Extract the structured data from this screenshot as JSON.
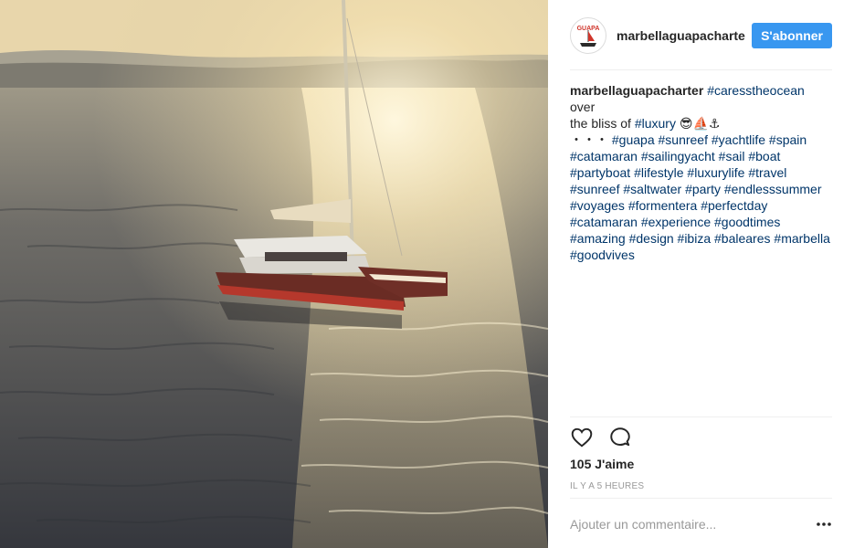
{
  "post": {
    "username": "marbellaguapacharte",
    "avatar_text": "GUAPA",
    "follow_label": "S'abonner",
    "caption": {
      "author": "marbellaguapacharter",
      "line1_tag": "#caresstheocean",
      "line1_text": "over",
      "line2_text": "the bliss of",
      "line2_tag": "#luxury",
      "line2_emoji": "😎⛵⚓",
      "line3_dots": "・・・",
      "hashtags": [
        "#guapa",
        "#sunreef",
        "#yachtlife",
        "#spain",
        "#catamaran",
        "#sailingyacht",
        "#sail",
        "#boat",
        "#partyboat",
        "#lifestyle",
        "#luxurylife",
        "#travel",
        "#sunreef",
        "#saltwater",
        "#party",
        "#endlesssummer",
        "#voyages",
        "#formentera",
        "#perfectday",
        "#catamaran",
        "#experience",
        "#goodtimes",
        "#amazing",
        "#design",
        "#ibiza",
        "#baleares",
        "#marbella",
        "#goodvives"
      ]
    },
    "likes": "105 J'aime",
    "timestamp": "IL Y A 5 HEURES",
    "comment_placeholder": "Ajouter un commentaire...",
    "icons": [
      "heart-icon",
      "comment-icon",
      "more-icon"
    ],
    "colors": {
      "follow": "#3897f0",
      "hashtag": "#003569"
    }
  }
}
